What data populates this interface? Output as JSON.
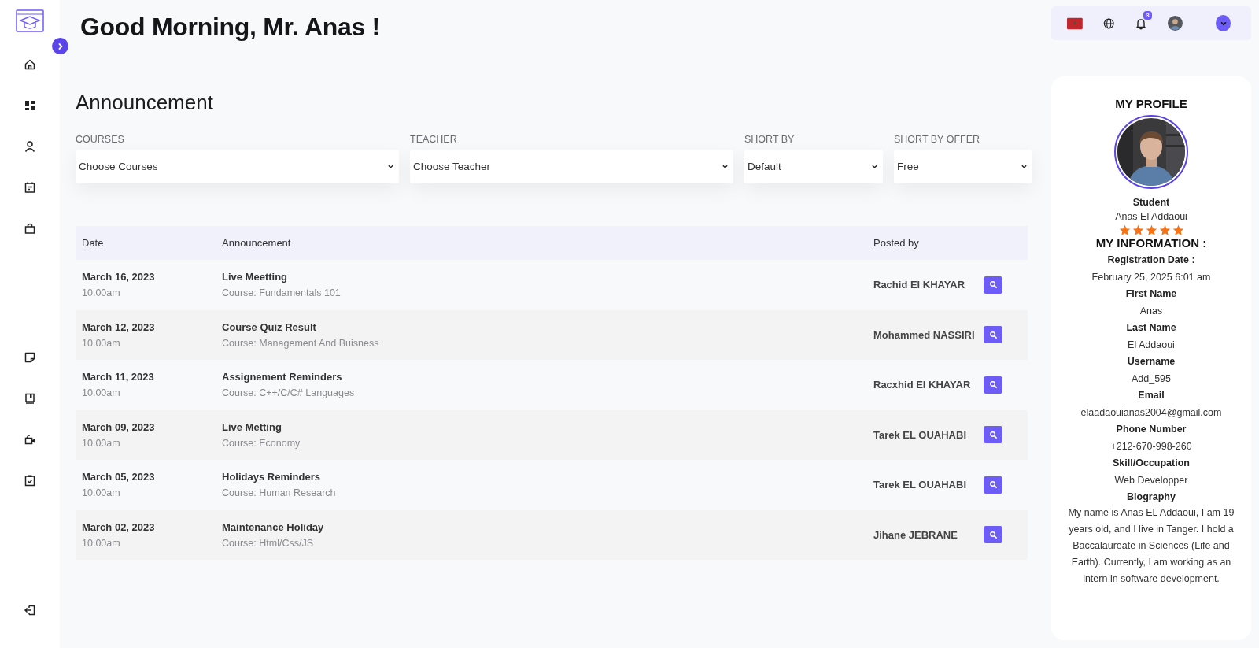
{
  "greeting": "Good Morning, Mr. Anas !",
  "sidebar": {
    "items": [
      {
        "kind": "home",
        "selected": false
      },
      {
        "kind": "dashboard",
        "selected": false
      },
      {
        "kind": "user",
        "selected": false
      },
      {
        "kind": "calendar",
        "selected": false
      },
      {
        "kind": "bag",
        "selected": false
      },
      {
        "kind": "note",
        "selected": false
      },
      {
        "kind": "book",
        "selected": false
      },
      {
        "kind": "camera",
        "selected": false
      },
      {
        "kind": "clipboard",
        "selected": false
      }
    ]
  },
  "topbar": {
    "notification_count": "3"
  },
  "page_title": "Announcement",
  "filters": [
    {
      "label": "COURSES",
      "value": "Choose Courses"
    },
    {
      "label": "TEACHER",
      "value": "Choose Teacher"
    },
    {
      "label": "SHORT BY",
      "value": "Default"
    },
    {
      "label": "SHORT BY OFFER",
      "value": "Free"
    }
  ],
  "table": {
    "columns": [
      "Date",
      "Announcement",
      "Posted by"
    ],
    "rows": [
      {
        "date": "March 16, 2023",
        "time": "10.00am",
        "title": "Live Meetting",
        "course": "Course: Fundamentals 101",
        "posted_by": "Rachid El KHAYAR"
      },
      {
        "date": "March 12, 2023",
        "time": "10.00am",
        "title": "Course Quiz Result",
        "course": "Course: Management And Buisness",
        "posted_by": "Mohammed NASSIRI"
      },
      {
        "date": "March 11, 2023",
        "time": "10.00am",
        "title": "Assignement Reminders",
        "course": "Course: C++/C/C# Languages",
        "posted_by": "Racxhid El KHAYAR"
      },
      {
        "date": "March 09, 2023",
        "time": "10.00am",
        "title": "Live Metting",
        "course": "Course: Economy",
        "posted_by": "Tarek EL OUAHABI"
      },
      {
        "date": "March 05, 2023",
        "time": "10.00am",
        "title": "Holidays Reminders",
        "course": "Course: Human Research",
        "posted_by": "Tarek EL OUAHABI"
      },
      {
        "date": "March 02, 2023",
        "time": "10.00am",
        "title": "Maintenance Holiday",
        "course": "Course: Html/Css/JS",
        "posted_by": "Jihane JEBRANE"
      }
    ]
  },
  "profile": {
    "title": "MY PROFILE",
    "role": "Student",
    "name": "Anas El Addaoui",
    "stars": 5,
    "info_title": "MY INFORMATION :",
    "fields": [
      {
        "label": "Registration Date :",
        "value": "February 25, 2025 6:01 am"
      },
      {
        "label": "First Name",
        "value": "Anas"
      },
      {
        "label": "Last Name",
        "value": "El Addaoui"
      },
      {
        "label": "Username",
        "value": "Add_595"
      },
      {
        "label": "Email",
        "value": "elaadaouianas2004@gmail.com"
      },
      {
        "label": "Phone Number",
        "value": "+212-670-998-260"
      },
      {
        "label": "Skill/Occupation",
        "value": "Web Developper"
      },
      {
        "label": "Biography",
        "value": "My name is Anas EL Addaoui, I am 19 years old, and I live in Tanger. I hold a Baccalaureate in Sciences (Life and Earth). Currently, I am working as an intern in software development."
      }
    ]
  }
}
